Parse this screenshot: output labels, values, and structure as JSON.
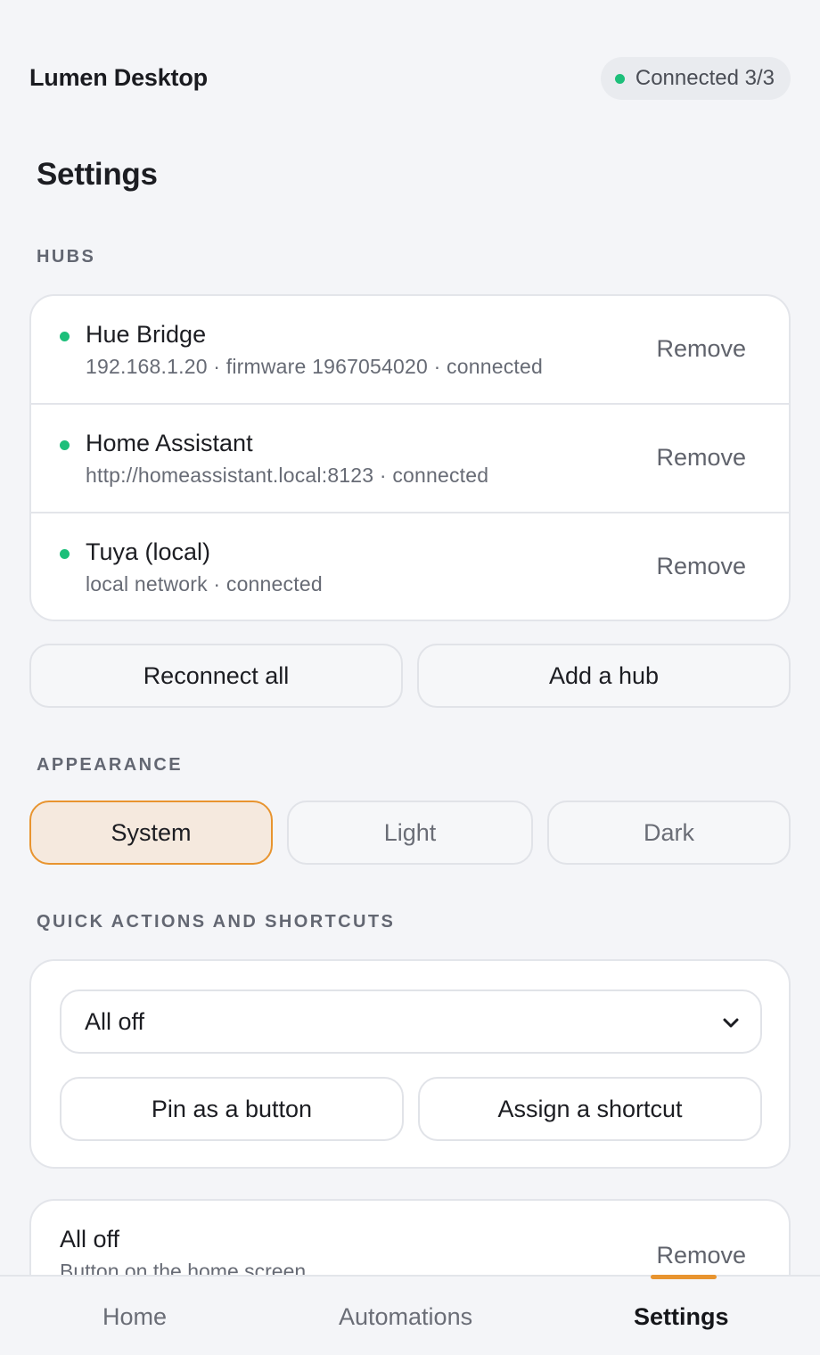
{
  "app": {
    "title": "Lumen Desktop",
    "connection_status": "Connected 3/3"
  },
  "page": {
    "title": "Settings"
  },
  "hubs": {
    "label": "HUBS",
    "items": [
      {
        "name": "Hue Bridge",
        "meta": "192.168.1.20 · firmware 1967054020 · connected",
        "remove_label": "Remove"
      },
      {
        "name": "Home Assistant",
        "meta": "http://homeassistant.local:8123 · connected",
        "remove_label": "Remove"
      },
      {
        "name": "Tuya (local)",
        "meta": "local network · connected",
        "remove_label": "Remove"
      }
    ],
    "reconnect_label": "Reconnect all",
    "add_label": "Add a hub"
  },
  "appearance": {
    "label": "APPEARANCE",
    "options": [
      "System",
      "Light",
      "Dark"
    ],
    "selected": "System"
  },
  "quick_actions": {
    "label": "QUICK ACTIONS AND SHORTCUTS",
    "selected_action": "All off",
    "pin_label": "Pin as a button",
    "shortcut_label": "Assign a shortcut",
    "pinned": [
      {
        "title": "All off",
        "subtitle": "Button on the home screen",
        "remove_label": "Remove"
      }
    ]
  },
  "nav": {
    "items": [
      "Home",
      "Automations",
      "Settings"
    ],
    "active": "Settings"
  },
  "colors": {
    "accent": "#e8942f",
    "status_ok": "#1dbf7a",
    "background": "#f4f5f8"
  }
}
